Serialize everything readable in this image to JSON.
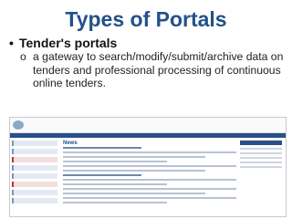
{
  "slide": {
    "title": "Types of Portals",
    "bullet_marker": "•",
    "bullet_label": "Tender's portals",
    "sub_marker": "o",
    "sub_text": "a gateway to search/modify/submit/archive data on tenders and professional processing of continuous online tenders."
  },
  "screenshot": {
    "news_heading": "News"
  },
  "colors": {
    "title": "#23518a",
    "nav_bar": "#2a4f8a"
  }
}
